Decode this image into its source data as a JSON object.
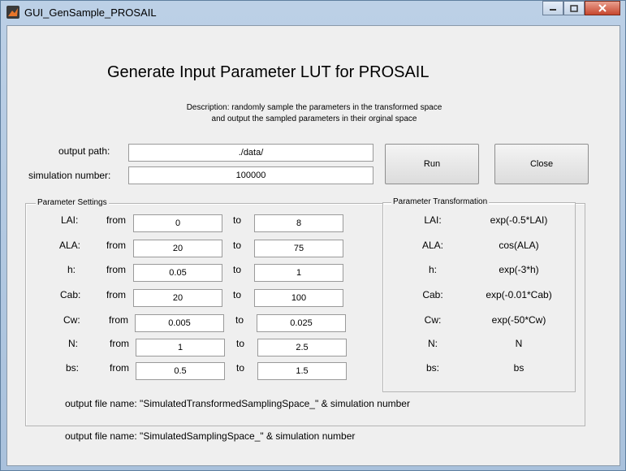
{
  "window": {
    "title": "GUI_GenSample_PROSAIL"
  },
  "heading": "Generate Input Parameter LUT for PROSAIL",
  "description": {
    "line1": "Description: randomly sample the parameters in the transformed space",
    "line2": "and output the sampled parameters in their orginal space"
  },
  "output_path": {
    "label": "output path:",
    "value": "./data/"
  },
  "simulation_number": {
    "label": "simulation number:",
    "value": "100000"
  },
  "buttons": {
    "run": "Run",
    "close": "Close"
  },
  "parameter_settings": {
    "title": "Parameter Settings",
    "from_label": "from",
    "to_label": "to",
    "rows": [
      {
        "name": "LAI:",
        "from": "0",
        "to": "8"
      },
      {
        "name": "ALA:",
        "from": "20",
        "to": "75"
      },
      {
        "name": "h:",
        "from": "0.05",
        "to": "1"
      },
      {
        "name": "Cab:",
        "from": "20",
        "to": "100"
      },
      {
        "name": "Cw:",
        "from": "0.005",
        "to": "0.025"
      },
      {
        "name": "N:",
        "from": "1",
        "to": "2.5"
      },
      {
        "name": "bs:",
        "from": "0.5",
        "to": "1.5"
      }
    ],
    "output_file_name": "output file name: \"SimulatedTransformedSamplingSpace_\" & simulation number"
  },
  "parameter_transformation": {
    "title": "Parameter Transformation",
    "rows": [
      {
        "name": "LAI:",
        "expr": "exp(-0.5*LAI)"
      },
      {
        "name": "ALA:",
        "expr": "cos(ALA)"
      },
      {
        "name": "h:",
        "expr": "exp(-3*h)"
      },
      {
        "name": "Cab:",
        "expr": "exp(-0.01*Cab)"
      },
      {
        "name": "Cw:",
        "expr": "exp(-50*Cw)"
      },
      {
        "name": "N:",
        "expr": "N"
      },
      {
        "name": "bs:",
        "expr": "bs"
      }
    ]
  },
  "bottom_output_file_name": "output file name: \"SimulatedSamplingSpace_\" & simulation number"
}
